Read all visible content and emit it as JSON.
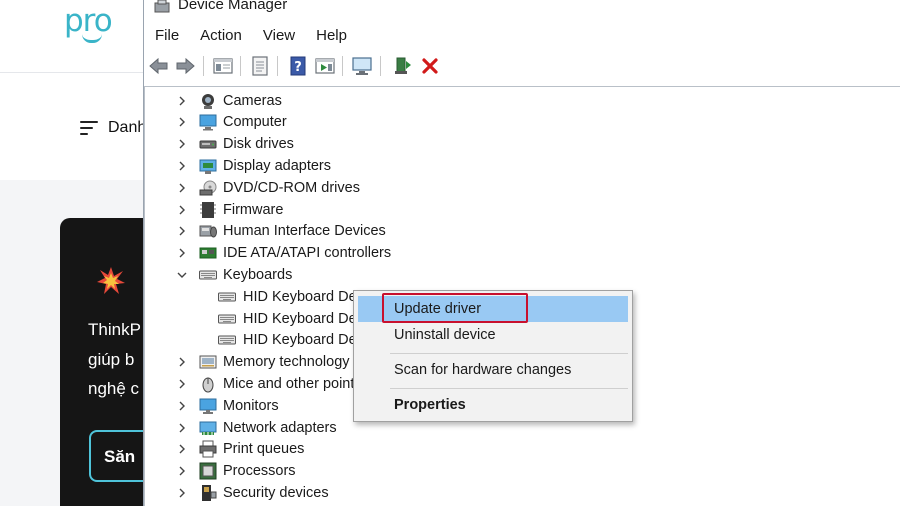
{
  "background_site": {
    "logo_text": "pro",
    "menu_label": "Danh",
    "card_lines": [
      "ThinkP",
      "giúp b",
      "nghệ c"
    ],
    "card_button": "Săn"
  },
  "window": {
    "title": "Device Manager",
    "menu": [
      "File",
      "Action",
      "View",
      "Help"
    ],
    "toolbar_icons": [
      "back-arrow-icon",
      "forward-arrow-icon",
      "show-hide-tree-icon",
      "properties-sheet-icon",
      "help-icon",
      "action-pane-icon",
      "monitor-scan-icon",
      "update-driver-icon",
      "uninstall-icon"
    ]
  },
  "tree": {
    "categories": [
      {
        "label": "Cameras",
        "icon": "camera-icon",
        "expanded": false
      },
      {
        "label": "Computer",
        "icon": "computer-icon",
        "expanded": false
      },
      {
        "label": "Disk drives",
        "icon": "disk-drive-icon",
        "expanded": false
      },
      {
        "label": "Display adapters",
        "icon": "display-adapter-icon",
        "expanded": false
      },
      {
        "label": "DVD/CD-ROM drives",
        "icon": "dvd-drive-icon",
        "expanded": false
      },
      {
        "label": "Firmware",
        "icon": "firmware-icon",
        "expanded": false
      },
      {
        "label": "Human Interface Devices",
        "icon": "hid-icon",
        "expanded": false
      },
      {
        "label": "IDE ATA/ATAPI controllers",
        "icon": "ide-controller-icon",
        "expanded": false
      },
      {
        "label": "Keyboards",
        "icon": "keyboard-icon",
        "expanded": true
      },
      {
        "label": "Memory technology",
        "icon": "memory-icon",
        "expanded": false
      },
      {
        "label": "Mice and other point",
        "icon": "mouse-icon",
        "expanded": false
      },
      {
        "label": "Monitors",
        "icon": "monitor-icon",
        "expanded": false
      },
      {
        "label": "Network adapters",
        "icon": "network-adapter-icon",
        "expanded": false
      },
      {
        "label": "Print queues",
        "icon": "printer-icon",
        "expanded": false
      },
      {
        "label": "Processors",
        "icon": "processor-icon",
        "expanded": false
      },
      {
        "label": "Security devices",
        "icon": "security-device-icon",
        "expanded": false
      }
    ],
    "keyboard_children": [
      "HID Keyboard Dev",
      "HID Keyboard De",
      "HID Keyboard De"
    ]
  },
  "context_menu": {
    "update_driver": "Update driver",
    "uninstall_device": "Uninstall device",
    "scan_hardware": "Scan for hardware changes",
    "properties": "Properties"
  },
  "colors": {
    "accent_highlight": "#99c9f3",
    "annotation_box": "#c8102e",
    "brand_teal": "#3ab4c8"
  }
}
